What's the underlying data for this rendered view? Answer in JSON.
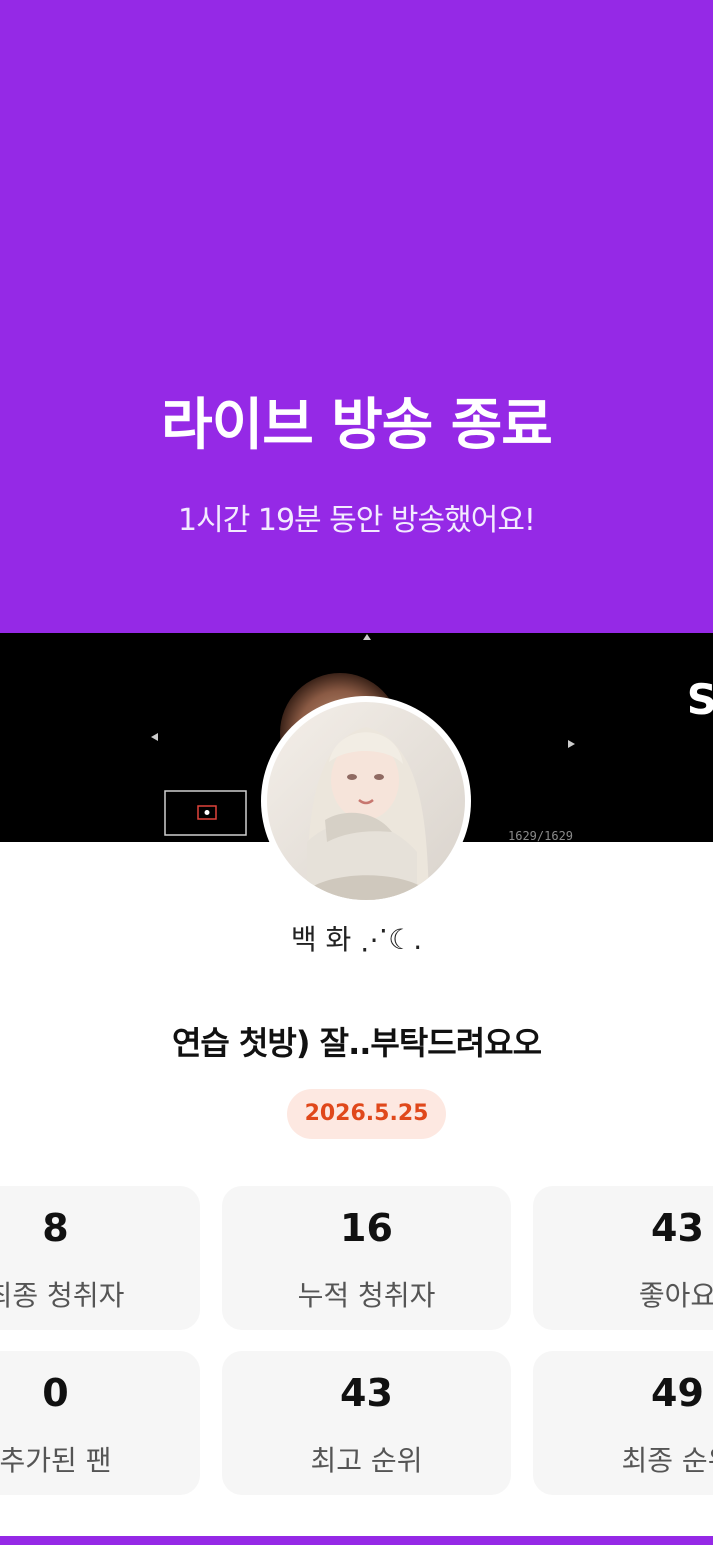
{
  "header": {
    "title": "라이브 방송 종료",
    "subtitle": "1시간 19분 동안 방송했어요!",
    "background_color": "#9529e6"
  },
  "banner": {
    "edge_letter": "S",
    "counter": "1629/1629"
  },
  "streamer": {
    "name": "백 화 ⋰☾."
  },
  "broadcast": {
    "title": "연습 첫방) 잘..부탁드려요오",
    "date": "2026.5.25"
  },
  "stats": [
    {
      "value": "8",
      "label": "최종 청취자"
    },
    {
      "value": "16",
      "label": "누적 청취자"
    },
    {
      "value": "43",
      "label": "좋아요"
    },
    {
      "value": "0",
      "label": "추가된 팬"
    },
    {
      "value": "43",
      "label": "최고 순위"
    },
    {
      "value": "49",
      "label": "최종 순위"
    }
  ],
  "colors": {
    "accent": "#9529e6",
    "date_text": "#e0481b",
    "date_bg": "#fde8e1",
    "card_bg": "#f6f6f6"
  }
}
